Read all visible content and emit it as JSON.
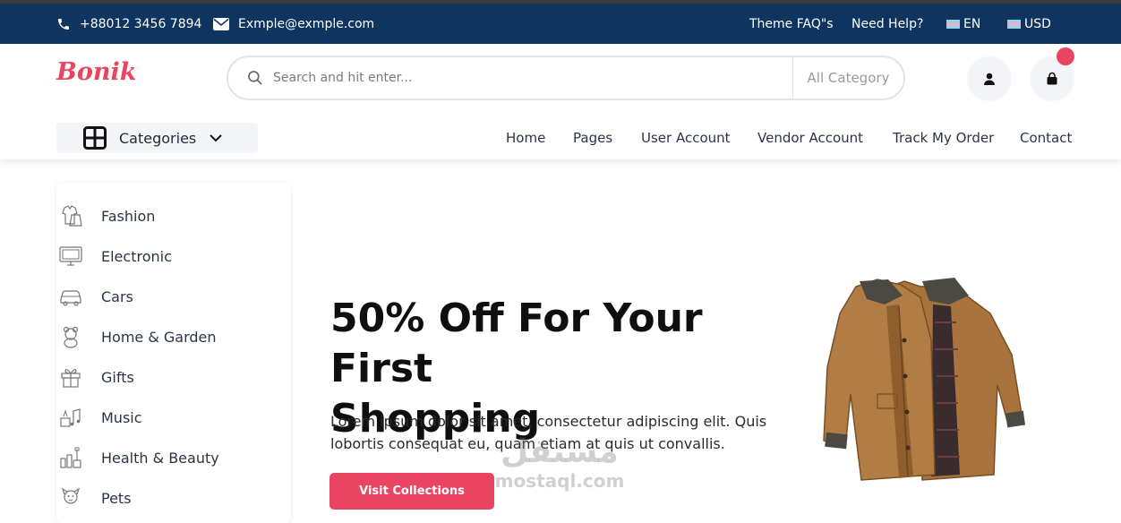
{
  "topbar": {
    "phone": "+88012 3456 7894",
    "email": "Exmple@exmple.com",
    "links": [
      "Theme FAQ\"s",
      "Need Help?"
    ],
    "language": "EN",
    "currency": "USD"
  },
  "header": {
    "logo": "Bonik",
    "search_placeholder": "Search and hit enter...",
    "search_category": "All Category",
    "categories_label": "Categories",
    "nav": [
      "Home",
      "Pages",
      "User Account",
      "Vendor Account",
      "Track My Order",
      "Contact"
    ]
  },
  "sidebar": {
    "items": [
      {
        "label": "Fashion",
        "icon": "fashion-icon"
      },
      {
        "label": "Electronic",
        "icon": "electronic-icon"
      },
      {
        "label": "Cars",
        "icon": "car-icon"
      },
      {
        "label": "Home & Garden",
        "icon": "home-garden-icon"
      },
      {
        "label": "Gifts",
        "icon": "gift-icon"
      },
      {
        "label": "Music",
        "icon": "music-icon"
      },
      {
        "label": "Health & Beauty",
        "icon": "health-beauty-icon"
      },
      {
        "label": "Pets",
        "icon": "pet-icon"
      }
    ]
  },
  "hero": {
    "title_line1": "50% Off For Your First",
    "title_line2": "Shopping",
    "desc_line1": "Lorem ipsum dolor sit amet, consectetur adipiscing elit. Quis",
    "desc_line2": "lobortis consequat eu, quam etiam at quis ut convallis.",
    "button": "Visit Collections"
  },
  "watermark": {
    "arabic": "مستقل",
    "latin": "mostaql.com"
  },
  "colors": {
    "topbar": "#0f3460",
    "accent": "#e94560"
  }
}
